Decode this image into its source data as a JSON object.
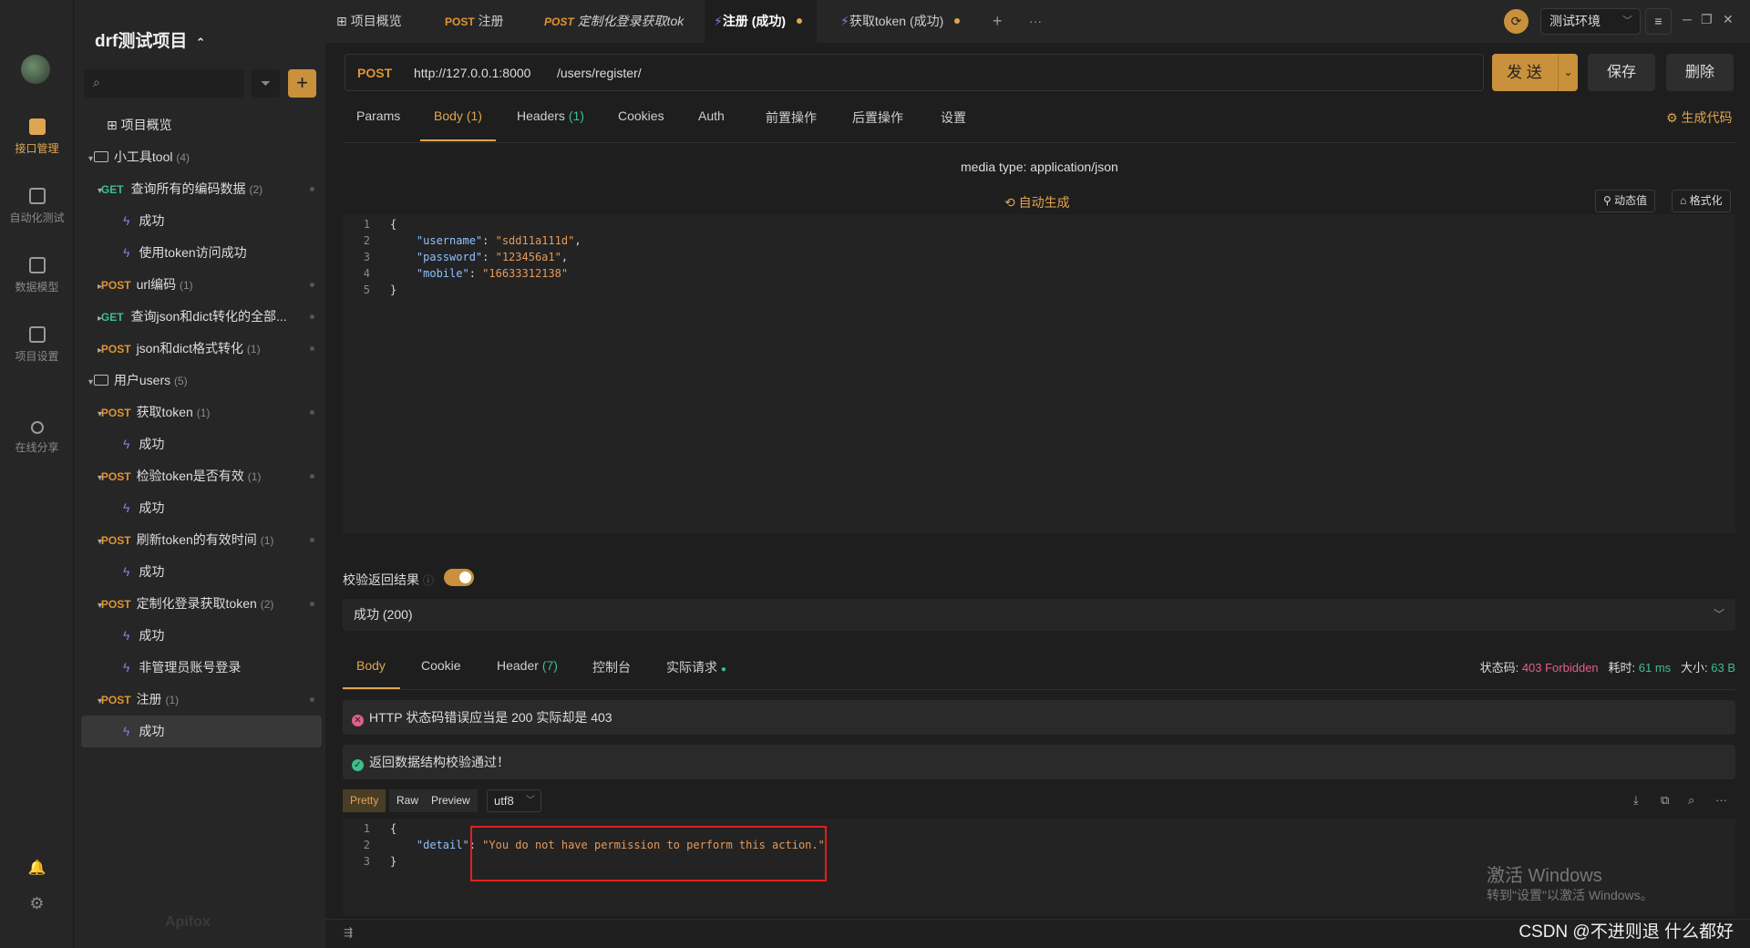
{
  "rail": {
    "items": [
      {
        "label": "接口管理",
        "icon": "api-icon",
        "active": true
      },
      {
        "label": "自动化测试",
        "icon": "automation-icon"
      },
      {
        "label": "数据模型",
        "icon": "data-model-icon"
      },
      {
        "label": "项目设置",
        "icon": "settings-icon"
      },
      {
        "label": "在线分享",
        "icon": "share-icon"
      }
    ],
    "bottom_icons": [
      "bell-icon",
      "gear-icon"
    ]
  },
  "sidebar": {
    "project_title": "drf测试项目",
    "project_switch_glyph": "⌃",
    "add_glyph": "+",
    "tree": [
      {
        "kind": "overview",
        "label": "项目概览"
      },
      {
        "kind": "folder",
        "label": "小工具tool",
        "count": "(4)"
      },
      {
        "kind": "api",
        "method": "GET",
        "label": "查询所有的编码数据",
        "count": "(2)"
      },
      {
        "kind": "case",
        "label": "成功"
      },
      {
        "kind": "case",
        "label": "使用token访问成功"
      },
      {
        "kind": "api",
        "method": "POST",
        "label": "url编码",
        "count": "(1)"
      },
      {
        "kind": "api",
        "method": "GET",
        "label": "查询json和dict转化的全部...",
        "count": ""
      },
      {
        "kind": "api",
        "method": "POST",
        "label": "json和dict格式转化",
        "count": "(1)"
      },
      {
        "kind": "folder",
        "label": "用户users",
        "count": "(5)"
      },
      {
        "kind": "api",
        "method": "POST",
        "label": "获取token",
        "count": "(1)"
      },
      {
        "kind": "case",
        "label": "成功"
      },
      {
        "kind": "api",
        "method": "POST",
        "label": "检验token是否有效",
        "count": "(1)"
      },
      {
        "kind": "case",
        "label": "成功"
      },
      {
        "kind": "api",
        "method": "POST",
        "label": "刷新token的有效时间",
        "count": "(1)"
      },
      {
        "kind": "case",
        "label": "成功"
      },
      {
        "kind": "api",
        "method": "POST",
        "label": "定制化登录获取token",
        "count": "(2)"
      },
      {
        "kind": "case",
        "label": "成功"
      },
      {
        "kind": "case",
        "label": "非管理员账号登录"
      },
      {
        "kind": "api",
        "method": "POST",
        "label": "注册",
        "count": "(1)"
      },
      {
        "kind": "case",
        "label": "成功",
        "selected": true
      }
    ],
    "logo_text": "Apifox"
  },
  "tabs": [
    {
      "label": "项目概览",
      "method": ""
    },
    {
      "label": "注册",
      "method": "POST"
    },
    {
      "label": "定制化登录获取tok",
      "method": "POST"
    },
    {
      "label": "注册 (成功)",
      "method": "⚡",
      "active": true
    },
    {
      "label": "获取token (成功)",
      "method": "⚡"
    }
  ],
  "tabbar": {
    "add": "+",
    "more": "···",
    "env": "测试环境"
  },
  "url": {
    "method": "POST",
    "host": "http://127.0.0.1:8000",
    "path": "/users/register/"
  },
  "actions": {
    "send": "发 送",
    "save": "保存",
    "delete": "删除"
  },
  "request_tabs": [
    {
      "label": "Params",
      "num": ""
    },
    {
      "label": "Body",
      "num": "(1)",
      "active": true
    },
    {
      "label": "Headers",
      "num": "(1)"
    },
    {
      "label": "Cookies",
      "num": ""
    },
    {
      "label": "Auth",
      "num": ""
    },
    {
      "label": "前置操作",
      "num": ""
    },
    {
      "label": "后置操作",
      "num": ""
    },
    {
      "label": "设置",
      "num": ""
    }
  ],
  "gen_code": "生成代码",
  "body": {
    "media_type": "media type: application/json",
    "auto_gen": "自动生成",
    "dynamic_value": "动态值",
    "format": "格式化",
    "lines": [
      {
        "n": "1",
        "parts": [
          {
            "t": "{",
            "c": "p"
          }
        ]
      },
      {
        "n": "2",
        "parts": [
          {
            "t": "    ",
            "c": "p"
          },
          {
            "t": "\"username\"",
            "c": "k"
          },
          {
            "t": ": ",
            "c": "p"
          },
          {
            "t": "\"sdd11a111d\"",
            "c": "s"
          },
          {
            "t": ",",
            "c": "p"
          }
        ]
      },
      {
        "n": "3",
        "parts": [
          {
            "t": "    ",
            "c": "p"
          },
          {
            "t": "\"password\"",
            "c": "k"
          },
          {
            "t": ": ",
            "c": "p"
          },
          {
            "t": "\"123456a1\"",
            "c": "s"
          },
          {
            "t": ",",
            "c": "p"
          }
        ]
      },
      {
        "n": "4",
        "parts": [
          {
            "t": "    ",
            "c": "p"
          },
          {
            "t": "\"mobile\"",
            "c": "k"
          },
          {
            "t": ": ",
            "c": "p"
          },
          {
            "t": "\"16633312138\"",
            "c": "s"
          }
        ]
      },
      {
        "n": "5",
        "parts": [
          {
            "t": "}",
            "c": "p"
          }
        ]
      }
    ]
  },
  "validate": {
    "label": "校验返回结果",
    "enabled": true,
    "response": "成功 (200)"
  },
  "response_tabs": [
    {
      "label": "Body",
      "num": "",
      "active": true
    },
    {
      "label": "Cookie",
      "num": ""
    },
    {
      "label": "Header",
      "num": "(7)"
    },
    {
      "label": "控制台",
      "num": ""
    },
    {
      "label": "实际请求",
      "num": ""
    }
  ],
  "status": {
    "code_label": "状态码:",
    "code": "403 Forbidden",
    "time_label": "耗时:",
    "time": "61 ms",
    "size_label": "大小:",
    "size": "63 B"
  },
  "alerts": {
    "error": "HTTP 状态码错误应当是 200 实际却是 403",
    "success": "返回数据结构校验通过！"
  },
  "format_buttons": {
    "pretty": "Pretty",
    "raw": "Raw",
    "preview": "Preview",
    "encoding": "utf8"
  },
  "response_body": {
    "lines": [
      {
        "n": "1",
        "parts": [
          {
            "t": "{",
            "c": "p"
          }
        ]
      },
      {
        "n": "2",
        "parts": [
          {
            "t": "    ",
            "c": "p"
          },
          {
            "t": "\"detail\"",
            "c": "k"
          },
          {
            "t": ": ",
            "c": "p"
          },
          {
            "t": "\"You do not have permission to perform this action.\"",
            "c": "s"
          }
        ]
      },
      {
        "n": "3",
        "parts": [
          {
            "t": "}",
            "c": "p"
          }
        ]
      }
    ]
  },
  "windows_notice": {
    "title": "激活 Windows",
    "sub": "转到\"设置\"以激活 Windows。"
  },
  "watermark": "CSDN @不进则退  什么都好",
  "colors": {
    "accent": "#c9913b",
    "post": "#e0952e",
    "get": "#3dbf8a",
    "error": "#e0608a",
    "highlight_box": "#e02020"
  }
}
